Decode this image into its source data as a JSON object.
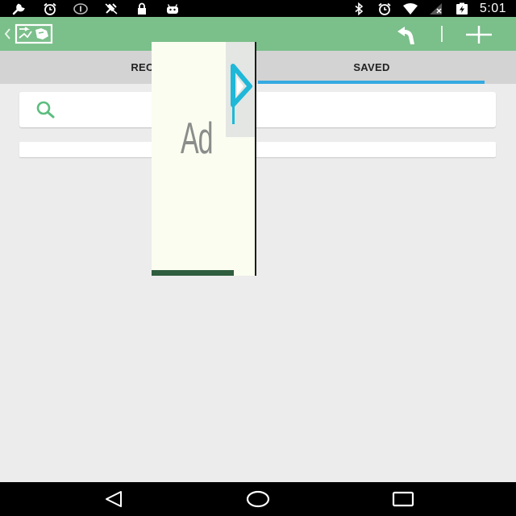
{
  "status_bar": {
    "time": "5:01",
    "left_icons": [
      "wrench-icon",
      "alarm-icon",
      "data-icon",
      "no-gps-icon",
      "lock-icon",
      "android-icon"
    ],
    "right_icons": [
      "bluetooth-icon",
      "alarm-icon",
      "wifi-icon",
      "no-signal-icon",
      "battery-charging-icon"
    ]
  },
  "action_bar": {
    "background": "#7bbf8a",
    "icons": [
      "chevron-left-icon",
      "map-logo-icon",
      "route-icon",
      "add-icon"
    ]
  },
  "tabs": {
    "items": [
      {
        "label": "RECE"
      },
      {
        "label": "SAVED"
      }
    ],
    "selected_index": 1,
    "indicator_color": "#35a9e0"
  },
  "search": {
    "value": "",
    "placeholder": "",
    "icon": "search-icon",
    "icon_color": "#5bbd7e"
  },
  "ad": {
    "label": "Ad",
    "icon": "play-triangle-icon",
    "icon_color": "#1fb8d8"
  },
  "nav_bar": {
    "icons": [
      "back-icon",
      "home-icon",
      "recents-icon"
    ]
  }
}
